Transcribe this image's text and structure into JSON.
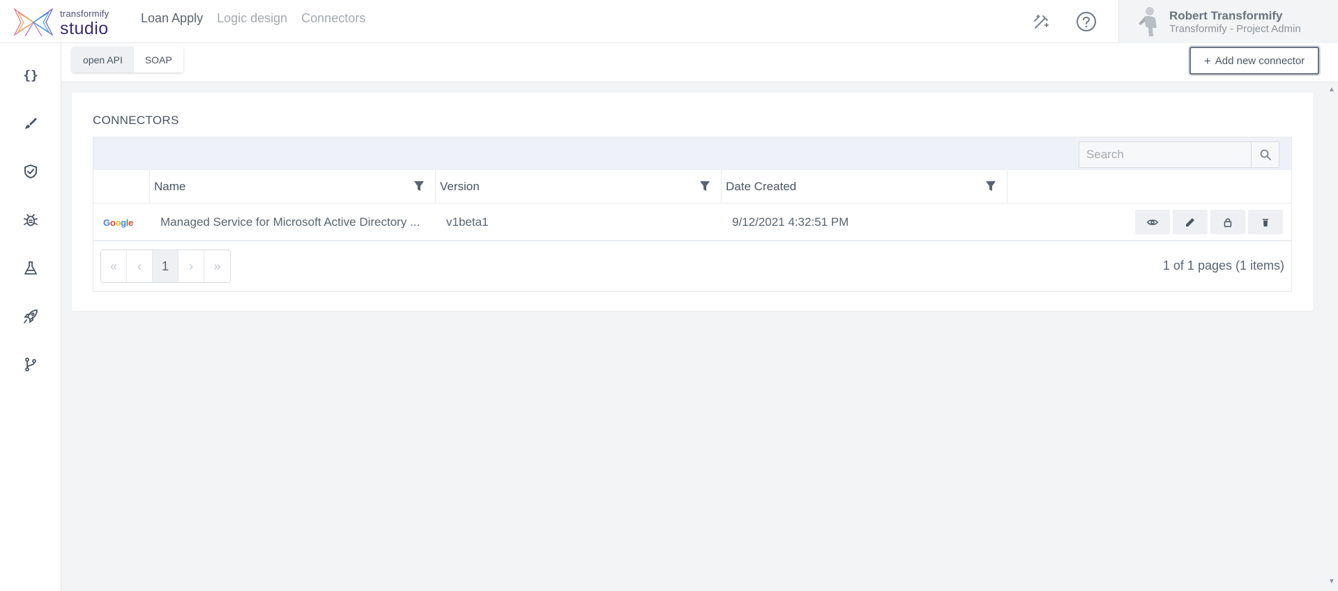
{
  "brand": {
    "top": "transformify",
    "bottom": "studio"
  },
  "nav": {
    "items": [
      "Loan Apply",
      "Logic design",
      "Connectors"
    ]
  },
  "user": {
    "name": "Robert Transformify",
    "role": "Transformify - Project Admin"
  },
  "toolbar": {
    "tabs": [
      "open API",
      "SOAP"
    ],
    "add_label": "Add new connector"
  },
  "card": {
    "title": "CONNECTORS"
  },
  "search": {
    "placeholder": "Search"
  },
  "table": {
    "columns": [
      "Name",
      "Version",
      "Date Created"
    ],
    "rows": [
      {
        "provider": "Google",
        "name": "Managed Service for Microsoft Active Directory ...",
        "version": "v1beta1",
        "date_created": "9/12/2021 4:32:51 PM"
      }
    ]
  },
  "pager": {
    "current_page": "1",
    "info": "1 of 1 pages (1 items)"
  },
  "icons": {
    "sidebar": [
      "braces-icon",
      "brush-icon",
      "shield-check-icon",
      "bug-icon",
      "flask-icon",
      "rocket-icon",
      "git-branch-icon"
    ],
    "row_actions": [
      "eye-icon",
      "pencil-icon",
      "lock-icon",
      "trash-icon"
    ]
  },
  "colors": {
    "accent": "#3b2a78",
    "muted_nav": "#a3aab3",
    "grid_toolbar": "#eef1f7"
  }
}
